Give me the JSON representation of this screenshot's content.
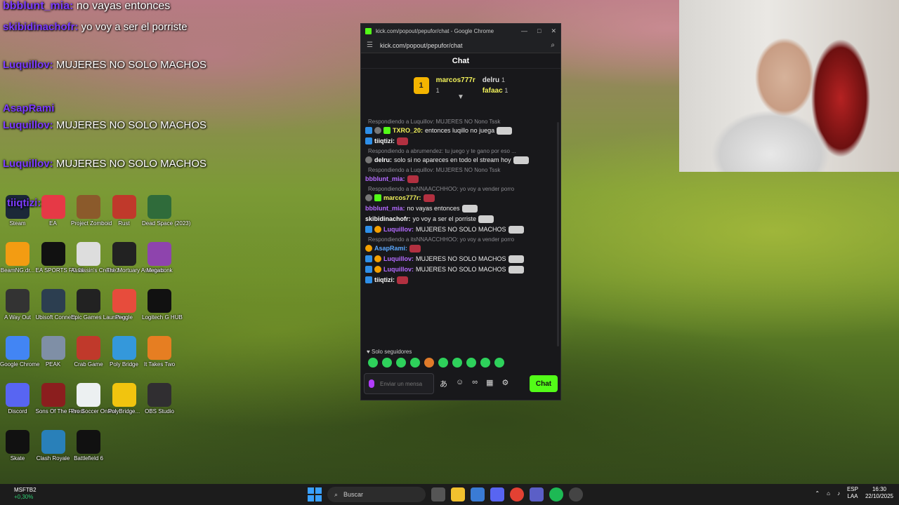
{
  "overlay": {
    "line1_user": "bbblunt_mia:",
    "line1_text": " no vayas entonces",
    "line2_user": "skibidinachofr:",
    "line2_text": " yo voy a ser el porriste",
    "line3_user": "Luquillov:",
    "line3_text": " MUJERES NO SOLO MACHOS",
    "line4_user": "AsapRami",
    "line5_user": "Luquillov:",
    "line5_text": " MUJERES NO SOLO MACHOS",
    "line6_user": "Luquillov:",
    "line6_text": " MUJERES NO SOLO MACHOS",
    "line7_user": "tiiqtizi:"
  },
  "desktop_icons": [
    {
      "label": "Steam",
      "color": "#1b2838"
    },
    {
      "label": "EA",
      "color": "#e63946"
    },
    {
      "label": "Project Zomboid",
      "color": "#8b5a2b"
    },
    {
      "label": "Rust",
      "color": "#c0392b"
    },
    {
      "label": "Dead Space (2023)",
      "color": "#2f6b3a"
    },
    {
      "label": "BeamNG.dr...",
      "color": "#f39c12"
    },
    {
      "label": "EA SPORTS FC 26",
      "color": "#111111"
    },
    {
      "label": "Assassin's Creed 1",
      "color": "#dddddd"
    },
    {
      "label": "The Mortuary Assistant",
      "color": "#222222"
    },
    {
      "label": "Megabonk",
      "color": "#8e44ad"
    },
    {
      "label": "A Way Out",
      "color": "#333333"
    },
    {
      "label": "Ubisoft Connect",
      "color": "#2c3e50"
    },
    {
      "label": "Epic Games Launcher",
      "color": "#222222"
    },
    {
      "label": "Peggle",
      "color": "#e74c3c"
    },
    {
      "label": "Logitech G HUB",
      "color": "#111111"
    },
    {
      "label": "Google Chrome",
      "color": "#4285f4"
    },
    {
      "label": "PEAK",
      "color": "#7f8fa6"
    },
    {
      "label": "Crab Game",
      "color": "#c0392b"
    },
    {
      "label": "Poly Bridge",
      "color": "#3498db"
    },
    {
      "label": "It Takes Two",
      "color": "#e67e22"
    },
    {
      "label": "Discord",
      "color": "#5865f2"
    },
    {
      "label": "Sons Of The Forest",
      "color": "#8b1e1e"
    },
    {
      "label": "Pro Soccer Online",
      "color": "#ecf0f1"
    },
    {
      "label": "PolyBridge...",
      "color": "#f1c40f"
    },
    {
      "label": "OBS Studio",
      "color": "#302e31"
    },
    {
      "label": "Skate",
      "color": "#111111"
    },
    {
      "label": "Clash Royale",
      "color": "#2980b9"
    },
    {
      "label": "Battlefield 6",
      "color": "#111111"
    }
  ],
  "chrome": {
    "title": "kick.com/popout/pepufor/chat - Google Chrome",
    "url": "kick.com/popout/pepufor/chat",
    "minimize": "—",
    "maximize": "□",
    "close": "✕"
  },
  "chat": {
    "header": "Chat",
    "leaderboard": {
      "rank": "1",
      "first_user": "marcos777r",
      "first_count": "1",
      "second_user": "delru",
      "second_count": "1",
      "third_user": "fafaac",
      "third_count": "1"
    },
    "messages": [
      {
        "reply": "Respondiendo a Luquillov: MUJERES NO Nono Tssk"
      },
      {
        "user": "TXRO_20:",
        "user_color": "#f2f25a",
        "text": "entonces luqillo no juega",
        "badges": [
          "blue",
          "gray",
          "green"
        ]
      },
      {
        "user": "tiiqtizi:",
        "user_color": "#ffffff",
        "text": "",
        "badges": [
          "blue"
        ]
      },
      {
        "reply": "Respondiendo a abrumendez: tu juego y te gano por eso ..."
      },
      {
        "user": "delru:",
        "user_color": "#ffffff",
        "text": "solo si no apareces en todo el stream hoy",
        "badges": [
          "gray"
        ]
      },
      {
        "reply": "Respondiendo a Luquillov: MUJERES NO Nono Tssk"
      },
      {
        "user": "bbblunt_mia:",
        "user_color": "#b46bff",
        "text": "",
        "badges": []
      },
      {
        "reply": "Respondiendo a itsNNAACCHHOO: yo voy a vender porro"
      },
      {
        "user": "marcos777r:",
        "user_color": "#f2f25a",
        "text": "",
        "badges": [
          "gray",
          "green"
        ]
      },
      {
        "user": "bbblunt_mia:",
        "user_color": "#b46bff",
        "text": "no vayas entonces",
        "badges": []
      },
      {
        "user": "skibidinachofr:",
        "user_color": "#ffffff",
        "text": "yo voy a ser el porriste",
        "badges": []
      },
      {
        "user": "Luquillov:",
        "user_color": "#b46bff",
        "text": "MUJERES NO SOLO MACHOS",
        "badges": [
          "blue",
          "gold"
        ]
      },
      {
        "reply": "Respondiendo a itsNNAACCHHOO: yo voy a vender porro"
      },
      {
        "user": "AsapRami:",
        "user_color": "#5aa8ff",
        "text": "",
        "badges": [
          "gold"
        ]
      },
      {
        "user": "Luquillov:",
        "user_color": "#b46bff",
        "text": "MUJERES NO SOLO MACHOS",
        "badges": [
          "blue",
          "gold"
        ]
      },
      {
        "user": "Luquillov:",
        "user_color": "#b46bff",
        "text": "MUJERES NO SOLO MACHOS",
        "badges": [
          "blue",
          "gold"
        ]
      },
      {
        "user": "tiiqtizi:",
        "user_color": "#ffffff",
        "text": "",
        "badges": [
          "blue"
        ]
      }
    ],
    "followers_only": "Solo seguidores",
    "input_placeholder": "Enviar un mensaje",
    "send_label": "Chat"
  },
  "taskbar": {
    "weather_name": "MSFTB2",
    "weather_change": "+0,30%",
    "search_placeholder": "Buscar",
    "lang": "ESP",
    "lang_sub": "LAA",
    "time": "16:30",
    "date": "22/10/2025"
  },
  "colors": {
    "kick_green": "#53fc18",
    "chat_bg": "#18181b",
    "taskbar_bg": "#1c1c1c"
  }
}
